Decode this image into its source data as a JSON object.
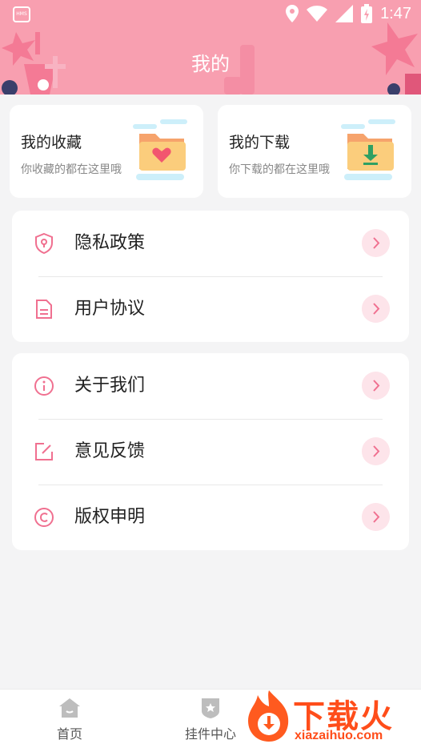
{
  "status": {
    "hms_label": "HMS",
    "time": "1:47"
  },
  "header": {
    "title": "我的"
  },
  "cards": [
    {
      "title": "我的收藏",
      "subtitle": "你收藏的都在这里哦",
      "icon": "favorite-folder-icon"
    },
    {
      "title": "我的下载",
      "subtitle": "你下载的都在这里哦",
      "icon": "download-folder-icon"
    }
  ],
  "menu_group_1": [
    {
      "label": "隐私政策",
      "icon": "shield-icon"
    },
    {
      "label": "用户协议",
      "icon": "document-icon"
    }
  ],
  "menu_group_2": [
    {
      "label": "关于我们",
      "icon": "info-icon"
    },
    {
      "label": "意见反馈",
      "icon": "edit-icon"
    },
    {
      "label": "版权申明",
      "icon": "copyright-icon"
    }
  ],
  "tabbar": {
    "tabs": [
      {
        "label": "首页",
        "icon": "home-icon"
      },
      {
        "label": "挂件中心",
        "icon": "badge-icon"
      }
    ]
  },
  "watermark": {
    "text": "下载火",
    "url": "xiazaihuo.com"
  },
  "colors": {
    "accent": "#f89fb0",
    "icon_pink": "#f07090",
    "arrow_bg": "#fde4ea",
    "background": "#f4f4f5"
  }
}
